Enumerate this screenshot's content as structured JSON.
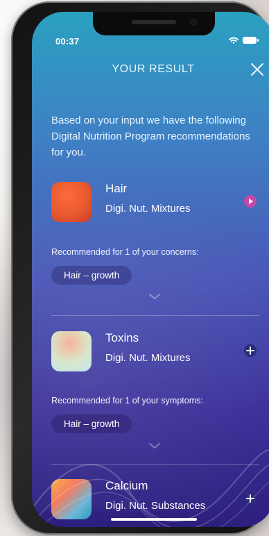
{
  "status": {
    "time": "00:37"
  },
  "header": {
    "title": "YOUR RESULT"
  },
  "intro": "Based on your input we have the following Digital Nutrition Program recommendations for you.",
  "items": [
    {
      "title": "Hair",
      "subtitle": "Digi. Nut. Mixtures",
      "recommended": "Recommended for 1 of your concerns:",
      "chip": "Hair – growth",
      "action_icon": "play-icon"
    },
    {
      "title": "Toxins",
      "subtitle": "Digi. Nut. Mixtures",
      "recommended": "Recommended for 1 of your symptoms:",
      "chip": "Hair – growth",
      "action_icon": "plus-icon"
    },
    {
      "title": "Calcium",
      "subtitle": "Digi. Nut. Substances",
      "action_icon": "plus-icon"
    }
  ],
  "colors": {
    "play_accent": "#c04aa5",
    "plus_bg": "#2b2b7a"
  }
}
